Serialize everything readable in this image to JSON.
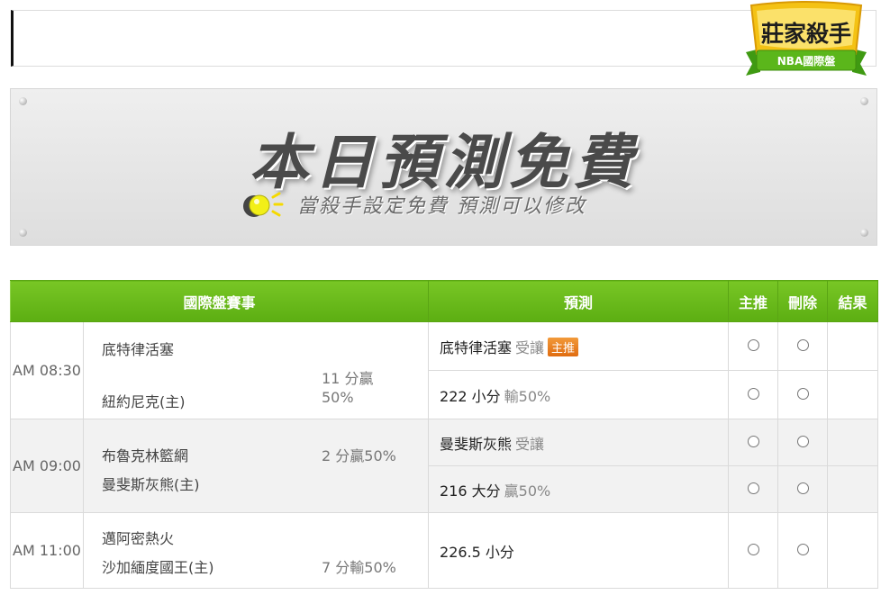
{
  "logo": {
    "title": "莊家殺手",
    "subtitle": "NBA國際盤"
  },
  "banner": {
    "title": "本日預測免費",
    "subtitle": "當殺手設定免費 預測可以修改",
    "bulb_icon": "lightbulb-icon"
  },
  "table": {
    "headers": {
      "game": "國際盤賽事",
      "prediction": "預測",
      "recommend": "主推",
      "delete": "刪除",
      "result": "結果"
    },
    "accent_color": "#66b91a",
    "rows": [
      {
        "time": "AM 08:30",
        "away": "底特律活塞",
        "home": "紐約尼克(主)",
        "odds_line1": "11 分贏",
        "odds_line2": "50%",
        "predictions": [
          {
            "pick": "底特律活塞",
            "note": "受讓",
            "tag": "主推"
          },
          {
            "pick": "222 小分",
            "note": "輸50%"
          }
        ]
      },
      {
        "time": "AM 09:00",
        "away": "布魯克林籃網",
        "home": "曼斐斯灰熊(主)",
        "odds": "2 分贏50%",
        "predictions": [
          {
            "pick": "曼斐斯灰熊",
            "note": "受讓"
          },
          {
            "pick": "216 大分",
            "note": "贏50%"
          }
        ]
      },
      {
        "time": "AM 11:00",
        "away": "邁阿密熱火",
        "home": "沙加緬度國王(主)",
        "odds": "7 分輸50%",
        "predictions": [
          {
            "pick": "226.5 小分"
          }
        ]
      }
    ]
  }
}
